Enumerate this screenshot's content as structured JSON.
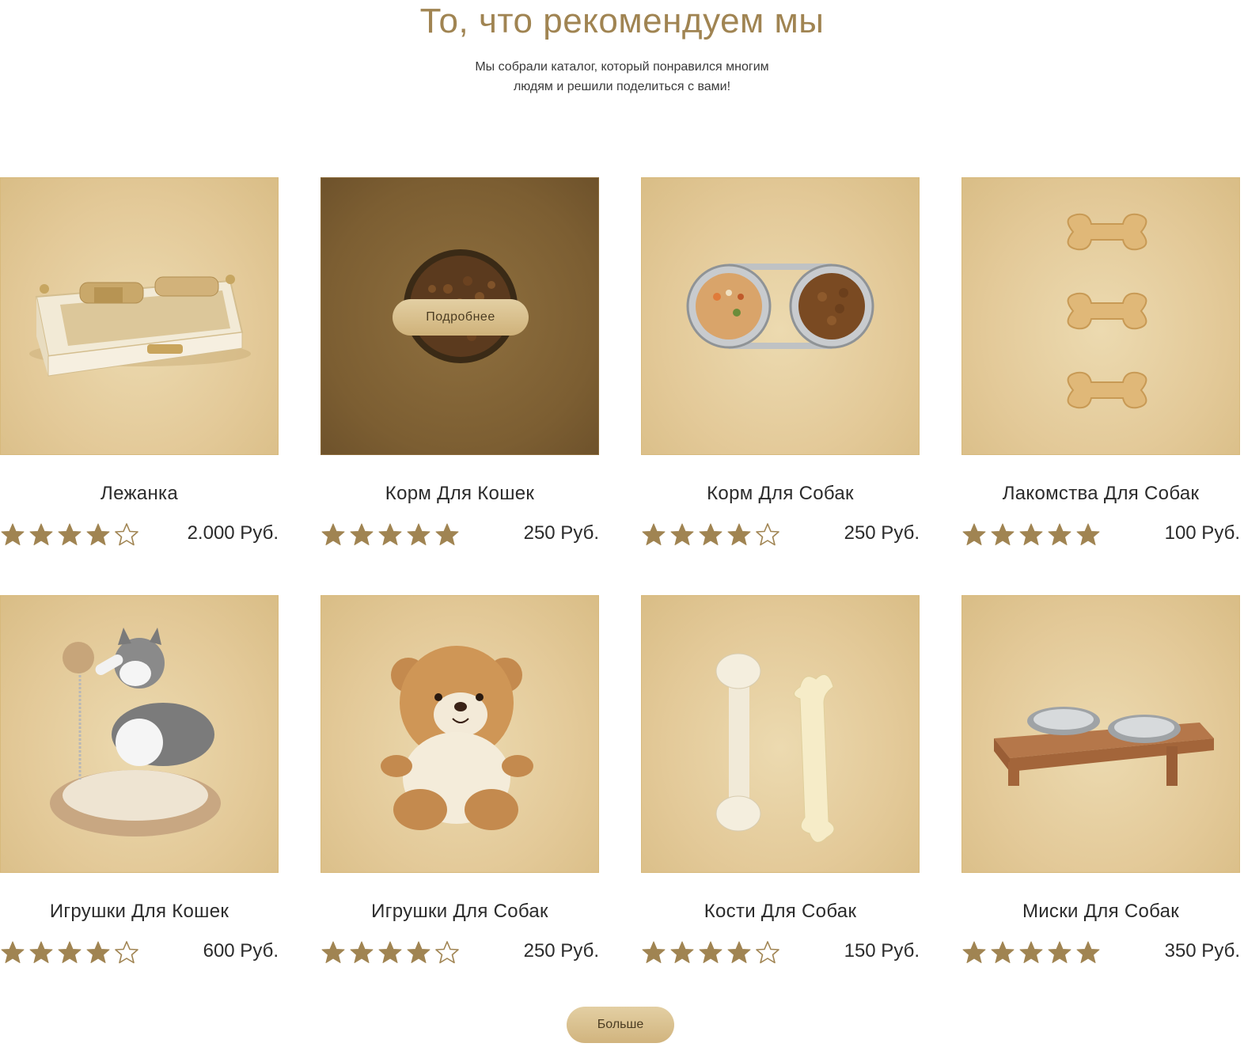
{
  "header": {
    "title": "То, что рекомендуем мы",
    "subtitle_line1": "Мы собрали каталог, который понравился многим",
    "subtitle_line2": "людям и решили поделиться с вами!"
  },
  "products": [
    {
      "name": "Лежанка",
      "price": "2.000 Руб.",
      "rating": 4,
      "image": "luxury-pet-bed"
    },
    {
      "name": "Корм Для Кошек",
      "price": "250 Руб.",
      "rating": 5,
      "image": "cat-food-bowl",
      "hover_button": "Подробнее"
    },
    {
      "name": "Корм Для Собак",
      "price": "250 Руб.",
      "rating": 4,
      "image": "dog-food-double-bowl"
    },
    {
      "name": "Лакомства Для Собак",
      "price": "100 Руб.",
      "rating": 5,
      "image": "bone-biscuits"
    },
    {
      "name": "Игрушки Для Кошек",
      "price": "600 Руб.",
      "rating": 4,
      "image": "kitten-scratcher-toy"
    },
    {
      "name": "Игрушки Для Собак",
      "price": "250 Руб.",
      "rating": 4,
      "image": "teddy-bear-toy"
    },
    {
      "name": "Кости Для Собак",
      "price": "150 Руб.",
      "rating": 4,
      "image": "chew-bones"
    },
    {
      "name": "Миски Для Собак",
      "price": "350 Руб.",
      "rating": 5,
      "image": "bowls-wooden-stand"
    }
  ],
  "load_more_label": "Больше",
  "colors": {
    "accent": "#a08452",
    "star": "#a08452",
    "card_bg": "#e3c998",
    "card_dark_bg": "#7c5e32",
    "button": "#d8bf8c"
  }
}
